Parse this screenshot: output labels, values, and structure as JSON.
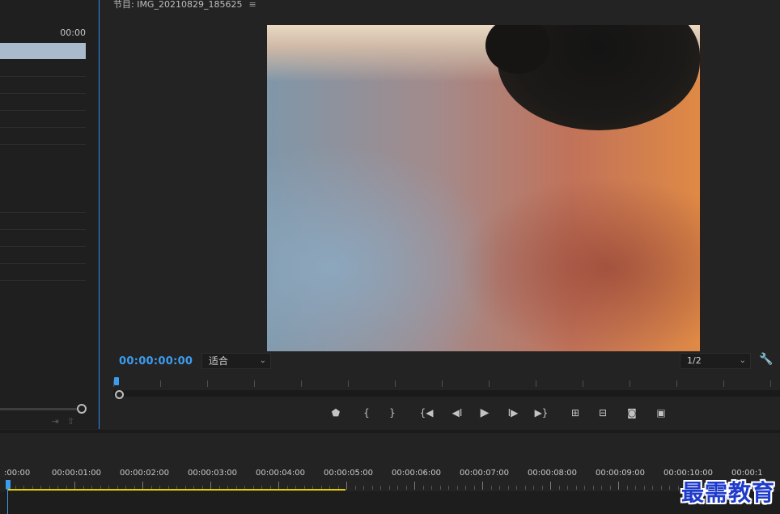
{
  "source_panel": {
    "timecode": "00:00",
    "icons": [
      "insert-icon",
      "export-icon"
    ]
  },
  "program_monitor": {
    "title": "节目: IMG_20210829_185625",
    "menu_icon": "≡",
    "timecode": "00:00:00:00",
    "fit_select": "适合",
    "resolution_select": "1/2",
    "settings_icon": "wrench-icon",
    "transport": [
      {
        "name": "add-marker-button",
        "glyph": "⬟"
      },
      {
        "name": "mark-in-button",
        "glyph": "{"
      },
      {
        "name": "mark-out-button",
        "glyph": "}"
      },
      {
        "name": "go-to-in-button",
        "glyph": "{◀"
      },
      {
        "name": "step-back-button",
        "glyph": "◀I"
      },
      {
        "name": "play-button",
        "glyph": "▶"
      },
      {
        "name": "step-forward-button",
        "glyph": "I▶"
      },
      {
        "name": "go-to-out-button",
        "glyph": "▶}"
      },
      {
        "name": "lift-button",
        "glyph": "⊞"
      },
      {
        "name": "extract-button",
        "glyph": "⊟"
      },
      {
        "name": "export-frame-button",
        "glyph": "◙"
      },
      {
        "name": "compare-view-button",
        "glyph": "▣"
      }
    ],
    "colors": {
      "accent": "#3c9cf0",
      "work_area": "#e6cf00"
    }
  },
  "timeline": {
    "timecodes": [
      ":00:00",
      "00:00:01:00",
      "00:00:02:00",
      "00:00:03:00",
      "00:00:04:00",
      "00:00:05:00",
      "00:00:06:00",
      "00:00:07:00",
      "00:00:08:00",
      "00:00:09:00",
      "00:00:10:00",
      "00:00:1"
    ]
  },
  "watermark": "最需教育"
}
